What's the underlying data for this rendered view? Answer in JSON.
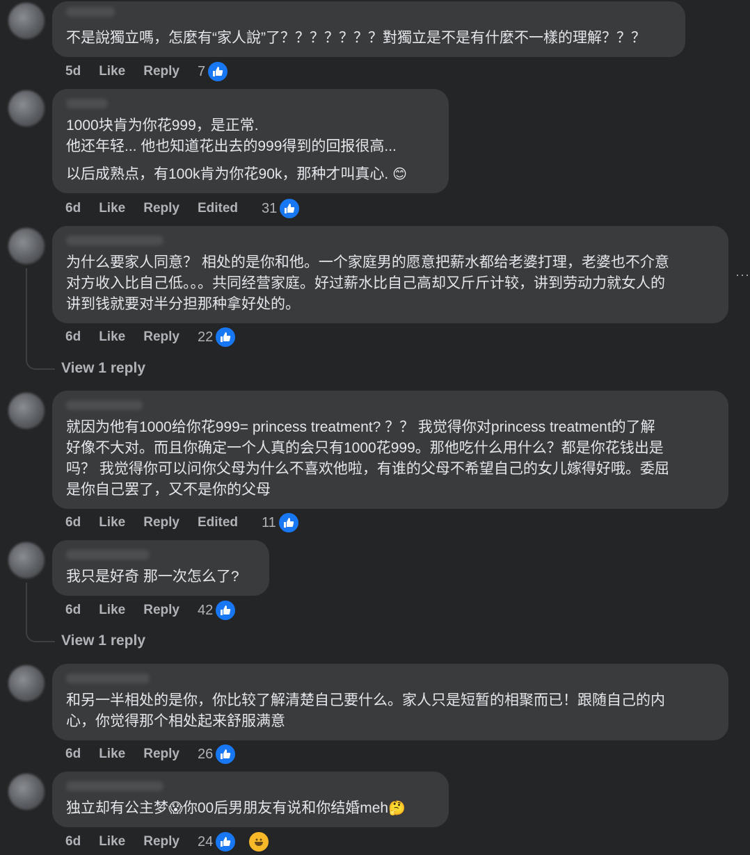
{
  "comments": [
    {
      "lines": [
        "不是說獨立嗎，怎麼有“家人說”了？？？？？？？對獨立是不是有什麼不一樣的理解？？？"
      ],
      "time": "5d",
      "like": "Like",
      "reply": "Reply",
      "edited": "",
      "count": "7"
    },
    {
      "lines": [
        "1000块肯为你花999，是正常.",
        "他还年轻... 他也知道花出去的999得到的回报很高...",
        "以后成熟点，有100k肯为你花90k，那种才叫真心."
      ],
      "time": "6d",
      "like": "Like",
      "reply": "Reply",
      "edited": "Edited",
      "count": "31"
    },
    {
      "lines": [
        "为什么要家人同意？ 相处的是你和他。一个家庭男的愿意把薪水都给老婆打理，老婆也不介意",
        "对方收入比自己低。。。共同经营家庭。好过薪水比自己高却又斤斤计较，讲到劳动力就女人的",
        "讲到钱就要对半分担那种拿好处的。"
      ],
      "time": "6d",
      "like": "Like",
      "reply": "Reply",
      "edited": "",
      "count": "22",
      "view_reply": "View 1 reply"
    },
    {
      "lines": [
        "就因为他有1000给你花999= princess treatment? ？？ 我觉得你对princess treatment的了解",
        "好像不大对。而且你确定一个人真的会只有1000花999。那他吃什么用什么？都是你花钱出是",
        "吗？ 我觉得你可以问你父母为什么不喜欢他啦，有谁的父母不希望自己的女儿嫁得好哦。委屈",
        "是你自己罢了，又不是你的父母"
      ],
      "time": "6d",
      "like": "Like",
      "reply": "Reply",
      "edited": "Edited",
      "count": "11"
    },
    {
      "lines": [
        "我只是好奇 那一次怎么了?"
      ],
      "time": "6d",
      "like": "Like",
      "reply": "Reply",
      "edited": "",
      "count": "42",
      "view_reply": "View 1 reply"
    },
    {
      "lines": [
        "和另一半相处的是你，你比较了解清楚自己要什么。家人只是短暂的相聚而已！跟随自己的内",
        "心，你觉得那个相处起来舒服满意"
      ],
      "time": "6d",
      "like": "Like",
      "reply": "Reply",
      "edited": "",
      "count": "26"
    },
    {
      "lines": [
        "独立却有公主梦",
        "你00后男朋友有说和你结婚meh"
      ],
      "time": "6d",
      "like": "Like",
      "reply": "Reply",
      "edited": "",
      "count": "24"
    }
  ],
  "more_indicator": "···",
  "colors": {
    "background": "#242526",
    "bubble": "#3a3b3c",
    "like_blue": "#1877f2",
    "meta_text": "#b0b3b8"
  }
}
